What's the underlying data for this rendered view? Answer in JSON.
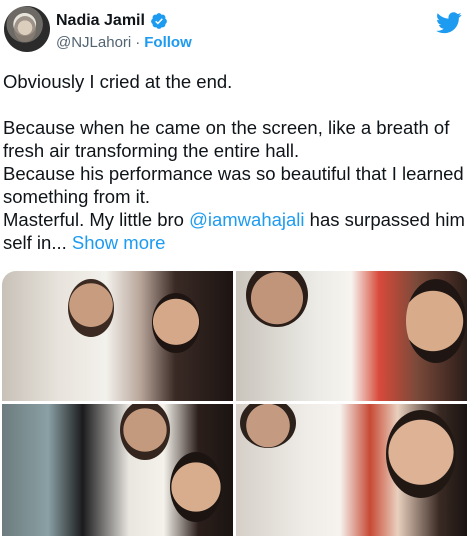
{
  "author": {
    "name": "Nadia Jamil",
    "handle": "@NJLahori",
    "separator": "·",
    "follow_label": "Follow",
    "avatar_icon": "user-avatar",
    "verified_icon": "verified-badge-icon"
  },
  "tweet": {
    "line1": "Obviously I cried at the end.",
    "line2": "Because when he came on the screen, like a breath of fresh air transforming the entire hall.",
    "line3": "Because his performance was so beautiful that I learned something from it.",
    "line4_pre": "Masterful. My little bro ",
    "mention": "@iamwahajali",
    "line4_post": " has surpassed him self in...",
    "show_more": "Show more"
  },
  "icons": {
    "platform": "twitter-bird-icon"
  },
  "colors": {
    "accent": "#1d9bf0",
    "text": "#0f1419",
    "muted": "#536471"
  },
  "media": {
    "photo_count": 4,
    "photos": [
      {
        "name": "photo-1",
        "label": "selfie-1"
      },
      {
        "name": "photo-2",
        "label": "selfie-2"
      },
      {
        "name": "photo-3",
        "label": "selfie-3"
      },
      {
        "name": "photo-4",
        "label": "selfie-4"
      }
    ]
  }
}
